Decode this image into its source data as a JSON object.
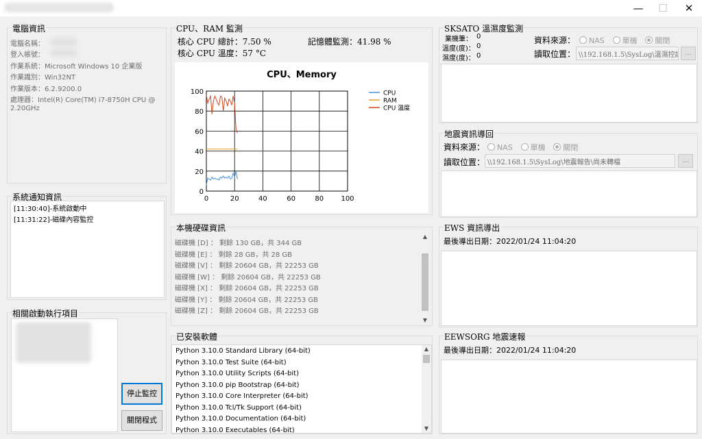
{
  "window": {
    "minimize_glyph": "—",
    "maximize_glyph": "☐",
    "close_glyph": "✕"
  },
  "computer_info": {
    "title": "電腦資訊",
    "lines": [
      "電腦名稱：",
      "登入帳號：",
      "作業系統：Microsoft Windows 10 企業版",
      "作業識別：Win32NT",
      "作業版本：6.2.9200.0",
      "處理器：Intel(R) Core(TM) i7-8750H CPU @",
      "2.20GHz"
    ]
  },
  "notifications": {
    "title": "系統通知資訊",
    "items": [
      "[11:30:40]-系統啟動中",
      "[11:31:22]-磁碟內容監控"
    ]
  },
  "startup_items": {
    "title": "相關啟動執行項目",
    "stop_button": "停止監控",
    "close_button": "關閉程式"
  },
  "cpu_ram": {
    "title": "CPU、RAM 監測",
    "cpu_total": "核心 CPU 總計：7.50 %",
    "cpu_temp": "核心 CPU 溫度：57 °C",
    "memory": "記憶體監測：41.98 %"
  },
  "chart_data": {
    "type": "line",
    "title": "CPU、Memory",
    "xlim": [
      0,
      100
    ],
    "ylim": [
      0,
      100
    ],
    "xticks": [
      "0",
      "20",
      "40",
      "60",
      "80",
      "100"
    ],
    "yticks": [
      "0",
      "20",
      "40",
      "60",
      "80",
      "100"
    ],
    "grid": true,
    "legend_position": "top-right",
    "series": [
      {
        "name": "CPU",
        "color": "#4a90d9",
        "x": [
          0,
          1,
          2,
          3,
          4,
          5,
          6,
          7,
          8,
          9,
          10,
          11,
          12,
          13,
          14,
          15,
          16,
          17,
          18,
          19,
          20,
          21,
          22
        ],
        "y": [
          6,
          13,
          12,
          11,
          14,
          12,
          13,
          12,
          12,
          11,
          14,
          13,
          15,
          13,
          14,
          13,
          15,
          12,
          13,
          18,
          14,
          20,
          12
        ]
      },
      {
        "name": "RAM",
        "color": "#f0a030",
        "x": [
          0,
          2,
          4,
          6,
          8,
          10,
          12,
          14,
          16,
          18,
          20,
          22
        ],
        "y": [
          42,
          42,
          42,
          42,
          42,
          42,
          42,
          42,
          42,
          42,
          42,
          42
        ]
      },
      {
        "name": "CPU 溫度",
        "color": "#d2461e",
        "x": [
          0,
          1,
          2,
          3,
          4,
          5,
          6,
          7,
          8,
          9,
          10,
          11,
          12,
          13,
          14,
          15,
          16,
          17,
          18,
          19,
          20,
          21,
          22
        ],
        "y": [
          96,
          88,
          92,
          95,
          77,
          90,
          95,
          92,
          88,
          86,
          95,
          94,
          80,
          93,
          90,
          85,
          92,
          90,
          86,
          95,
          88,
          62,
          58
        ]
      }
    ]
  },
  "disk_info": {
    "title": "本機硬碟資訊",
    "lines": [
      "磁碟機 [D] ： 剩餘 130 GB，共 344 GB",
      "磁碟機 [E] ： 剩餘 28 GB，共 28 GB",
      "磁碟機 [V] ： 剩餘 20604 GB，共 22253 GB",
      "磁碟機 [W] ： 剩餘 20604 GB，共 22253 GB",
      "磁碟機 [X] ： 剩餘 20604 GB，共 22253 GB",
      "磁碟機 [Y] ： 剩餘 20604 GB，共 22253 GB",
      "磁碟機 [Z] ： 剩餘 20604 GB，共 22253 GB"
    ]
  },
  "installed_software": {
    "title": "已安裝軟體",
    "items": [
      "Python 3.10.0 Standard Library (64-bit)",
      "Python 3.10.0 Test Suite (64-bit)",
      "Python 3.10.0 Utility Scripts (64-bit)",
      "Python 3.10.0 pip Bootstrap (64-bit)",
      "Python 3.10.0 Core Interpreter (64-bit)",
      "Python 3.10.0 Tcl/Tk Support (64-bit)",
      "Python 3.10.0 Documentation (64-bit)",
      "Python 3.10.0 Executables (64-bit)"
    ]
  },
  "sksato": {
    "title": "SKSATO 溫濕度監測",
    "machine": "業機筆：",
    "machine_val": "0",
    "temp": "溫度(度)：",
    "temp_val": "0",
    "humidity": "濕度(度)：",
    "humidity_val": "0",
    "source_label": "資料來源：",
    "path_label": "讀取位置：",
    "path_value": "\\\\192.168.1.5\\SysLog\\溫濕控誼",
    "browse": "...",
    "options": [
      "NAS",
      "單機",
      "關閉"
    ]
  },
  "quake_import": {
    "title": "地震資訊導回",
    "source_label": "資料來源：",
    "path_label": "讀取位置：",
    "path_value": "\\\\192.168.1.5\\SysLog\\地震報告\\尚未轉檔",
    "browse": "...",
    "options": [
      "NAS",
      "單機",
      "關閉"
    ]
  },
  "ews": {
    "title": "EWS 資訊導出",
    "last_export": "最後導出日期：2022/01/24 11:04:20"
  },
  "eewsorg": {
    "title": "EEWSORG 地震速報",
    "last_export": "最後導出日期：2022/01/24 11:04:20"
  }
}
